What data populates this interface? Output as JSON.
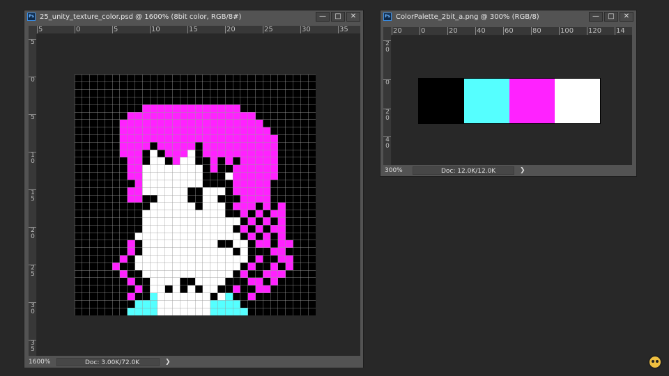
{
  "windows": [
    {
      "title": "25_unity_texture_color.psd @ 1600% (8bit color, RGB/8#)",
      "status_zoom": "1600%",
      "status_doc": "Doc: 3.00K/72.0K",
      "ruler_h": [
        "5",
        "0",
        "5",
        "10",
        "15",
        "20",
        "25",
        "30",
        "35"
      ],
      "ruler_v": [
        "5",
        "0",
        "5",
        "1\n0",
        "1\n5",
        "2\n0",
        "2\n5",
        "3\n0",
        "3\n5"
      ]
    },
    {
      "title": "ColorPalette_2bit_a.png @ 300% (RGB/8)",
      "status_zoom": "300%",
      "status_doc": "Doc: 12.0K/12.0K",
      "ruler_h": [
        "20",
        "0",
        "20",
        "40",
        "60",
        "80",
        "100",
        "120",
        "14"
      ],
      "ruler_v": [
        "2\n0",
        "0",
        "2\n0",
        "4\n0"
      ]
    }
  ],
  "icons": {
    "app": "photoshop-icon",
    "minimize": "minimize-icon",
    "maximize": "maximize-icon",
    "close": "close-icon",
    "status_arrow": "chevron-right-icon",
    "badge": "owl-logo-icon"
  },
  "palette": [
    "#000000",
    "#55ffff",
    "#ff22ff",
    "#ffffff"
  ],
  "pixel_art": {
    "width": 32,
    "height": 32,
    "colors": {
      "0": "#000000",
      "1": "#55ffff",
      "2": "#ff22ff",
      "3": "#ffffff"
    },
    "rows": [
      "00000000000000000000000000000000",
      "00000000000000000000000000000000",
      "00000000000000000000000000000000",
      "00000000000000000000000000000000",
      "00000000022222222222220000000000",
      "00000002222222222222222200000000",
      "00000022222222222222222220000000",
      "00000022222222222222222222000000",
      "00000022222222222222222222200000",
      "00000022220222220222222222200000",
      "00000022203022230222222222200000",
      "00000002203302330020202222200000",
      "00000002233333333020022222200000",
      "00000002233333333000322222200000",
      "00000000233333333000022222000000",
      "00000002233333300333022222000000",
      "00000002200333300330002222000000",
      "00000000003333330333022202020000",
      "00000000033333333333002020220000",
      "00000000033333333333330202020000",
      "00000000033333333333302020220000",
      "00000000333333333333330202020000",
      "00000002033333333330033022022000",
      "00000002033333333333303000220000",
      "00000020333333333333333020022000",
      "00000200333333333333330200202000",
      "00000020033333333333302002220000",
      "00000002003333003333000220200000",
      "00000000203303030330020022000000",
      "00000002001333333303100200000000",
      "00000000111333333311110000000000",
      "00000001111333333311111000000000"
    ]
  }
}
